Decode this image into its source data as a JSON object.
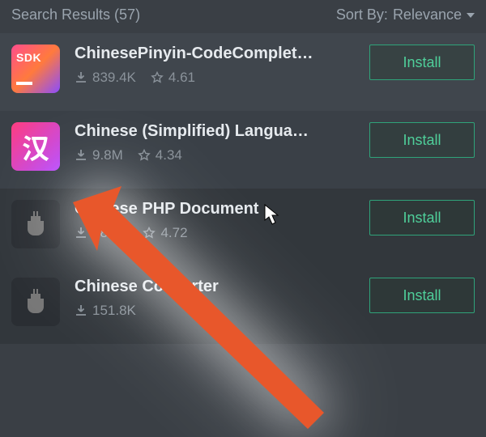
{
  "header": {
    "results_label": "Search Results (57)",
    "sort_label": "Sort By:",
    "sort_value": "Relevance"
  },
  "items": [
    {
      "icon_kind": "sdk",
      "icon_text": "SDK",
      "title": "ChinesePinyin-CodeComplet…",
      "downloads": "839.4K",
      "rating": "4.61",
      "install": "Install"
    },
    {
      "icon_kind": "han",
      "icon_text": "汉",
      "title": "Chinese (Simplified) Langua…",
      "downloads": "9.8M",
      "rating": "4.34",
      "install": "Install"
    },
    {
      "icon_kind": "plug",
      "title": "Chinese PHP Document",
      "downloads": "48.1K",
      "rating": "4.72",
      "install": "Install"
    },
    {
      "icon_kind": "plug",
      "title": "Chinese Converter",
      "downloads": "151.8K",
      "rating": "",
      "install": "Install"
    }
  ]
}
